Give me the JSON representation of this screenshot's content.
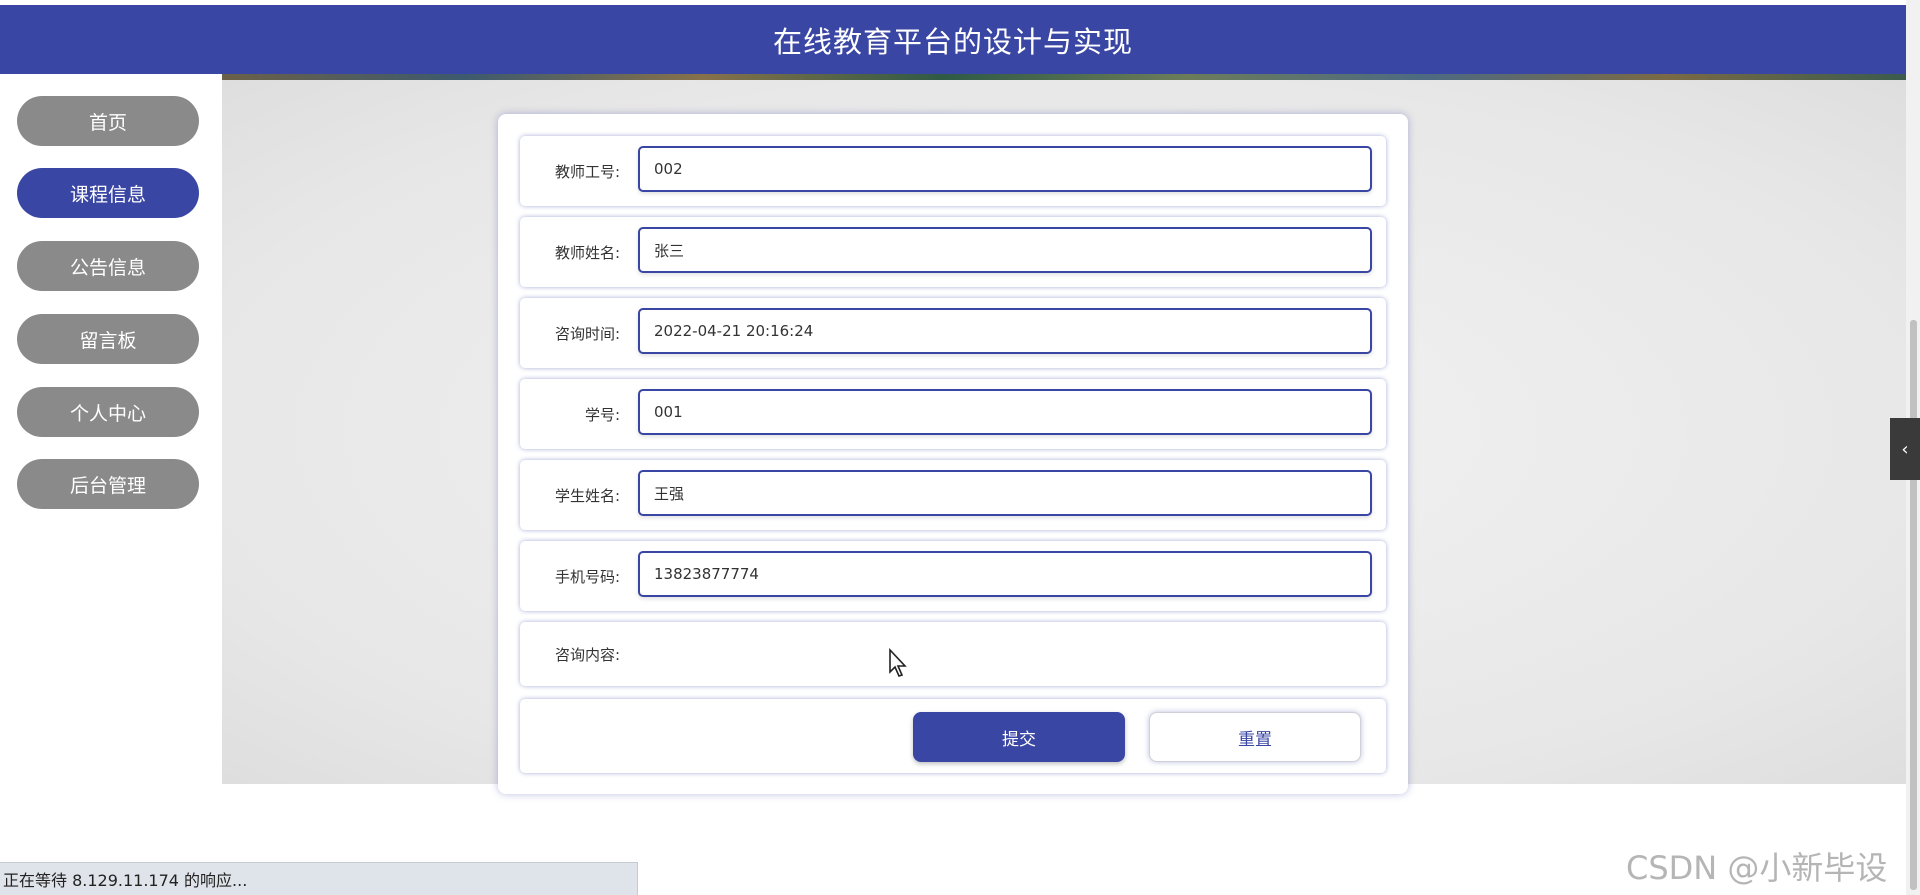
{
  "header": {
    "title": "在线教育平台的设计与实现"
  },
  "sidebar": {
    "items": [
      {
        "label": "首页"
      },
      {
        "label": "课程信息",
        "active": true
      },
      {
        "label": "公告信息"
      },
      {
        "label": "留言板"
      },
      {
        "label": "个人中心"
      },
      {
        "label": "后台管理"
      }
    ]
  },
  "form": {
    "teacher_id": {
      "label": "教师工号:",
      "value": "002"
    },
    "teacher_name": {
      "label": "教师姓名:",
      "value": "张三"
    },
    "consult_time": {
      "label": "咨询时间:",
      "value": "2022-04-21 20:16:24"
    },
    "student_id": {
      "label": "学号:",
      "value": "001"
    },
    "student_name": {
      "label": "学生姓名:",
      "value": "王强"
    },
    "phone": {
      "label": "手机号码:",
      "value": "13823877774"
    },
    "consult_content": {
      "label": "咨询内容:"
    },
    "submit_label": "提交",
    "reset_label": "重置"
  },
  "status_bar": {
    "text": "正在等待 8.129.11.174 的响应..."
  },
  "watermark": "CSDN @小新毕设",
  "colors": {
    "accent": "#3a46a3",
    "nav_inactive": "#8a8a8a"
  },
  "icons": {
    "side_toggle": "chevron-left-icon",
    "cursor": "mouse-pointer-icon"
  }
}
